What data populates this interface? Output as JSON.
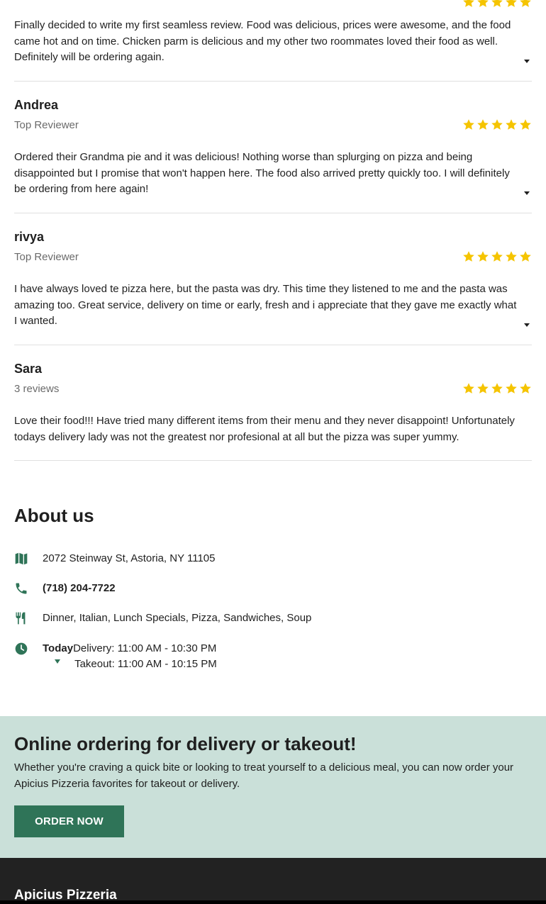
{
  "reviews": [
    {
      "name": "",
      "subtitle": "",
      "rating": 5,
      "text": "Finally decided to write my first seamless review. Food was delicious, prices were awesome, and the food came hot and on time. Chicken parm is delicious and my other two roommates loved their food as well. Definitely will be ordering again."
    },
    {
      "name": "Andrea",
      "subtitle": "Top Reviewer",
      "rating": 5,
      "text": "Ordered their Grandma pie and it was delicious! Nothing worse than splurging on pizza and being disappointed but I promise that won't happen here. The food also arrived pretty quickly too. I will definitely be ordering from here again!"
    },
    {
      "name": "rivya",
      "subtitle": "Top Reviewer",
      "rating": 5,
      "text": "I have always loved te pizza here, but the pasta was dry. This time they listened to me and the pasta was amazing too. Great service, delivery on time or early, fresh and i appreciate that they gave me exactly what I wanted."
    },
    {
      "name": "Sara",
      "subtitle": "3 reviews",
      "rating": 5,
      "text": "Love their food!!! Have tried many different items from their menu and they never disappoint! Unfortunately todays delivery lady was not the greatest nor profesional at all but the pizza was super yummy."
    }
  ],
  "about": {
    "title": "About us",
    "address": "2072 Steinway St, Astoria, NY 11105",
    "phone": "(718) 204-7722",
    "cuisines": "Dinner, Italian, Lunch Specials, Pizza, Sandwiches, Soup",
    "hours_day": "Today",
    "delivery_hours": "Delivery: 11:00 AM - 10:30 PM",
    "takeout_hours": "Takeout: 11:00 AM - 10:15 PM"
  },
  "promo": {
    "title": "Online ordering for delivery or takeout!",
    "text": "Whether you're craving a quick bite or looking to treat yourself to a delicious meal, you can now order your Apicius Pizzeria favorites for takeout or delivery.",
    "button_label": "ORDER NOW"
  },
  "footer": {
    "restaurant_name": "Apicius Pizzeria"
  },
  "colors": {
    "star": "#f5c400",
    "icon": "#2f7458",
    "promo_bg": "#cae0d9",
    "button_bg": "#2f7458",
    "footer_bg": "#222222"
  },
  "icons": {
    "address": "map-icon",
    "phone": "phone-icon",
    "cuisine": "utensils-icon",
    "hours": "clock-icon",
    "rating": "star-icon",
    "expand": "caret-down-icon"
  }
}
